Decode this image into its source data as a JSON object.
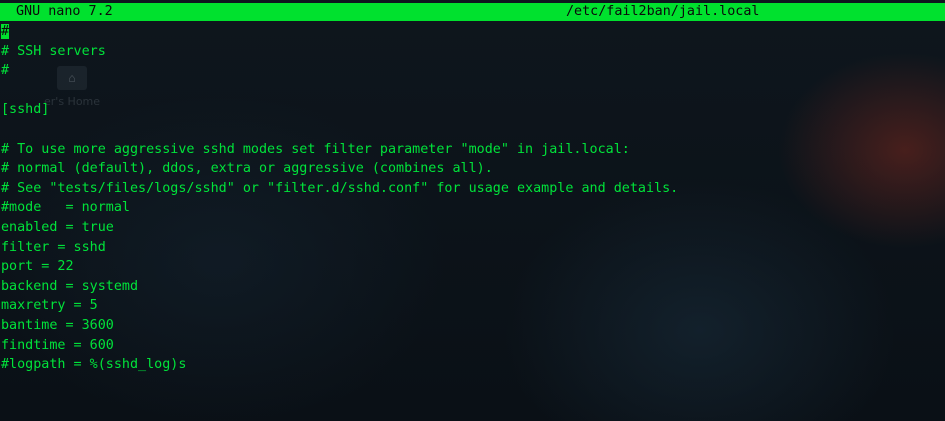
{
  "titlebar": {
    "app": "GNU nano 7.2",
    "file": "/etc/fail2ban/jail.local"
  },
  "desktop": {
    "ghost_label": "er's Home",
    "ghost_icon": "home-icon"
  },
  "editor": {
    "cursor_char": "#",
    "lines": [
      "",
      "# SSH servers",
      "#",
      "",
      "[sshd]",
      "",
      "# To use more aggressive sshd modes set filter parameter \"mode\" in jail.local:",
      "# normal (default), ddos, extra or aggressive (combines all).",
      "# See \"tests/files/logs/sshd\" or \"filter.d/sshd.conf\" for usage example and details.",
      "#mode   = normal",
      "enabled = true",
      "filter = sshd",
      "port = 22",
      "backend = systemd",
      "maxretry = 5",
      "bantime = 3600",
      "findtime = 600",
      "#logpath = %(sshd_log)s"
    ]
  },
  "colors": {
    "text": "#00e33a",
    "titlebar_bg": "#00e12e",
    "background": "#0b1218"
  }
}
